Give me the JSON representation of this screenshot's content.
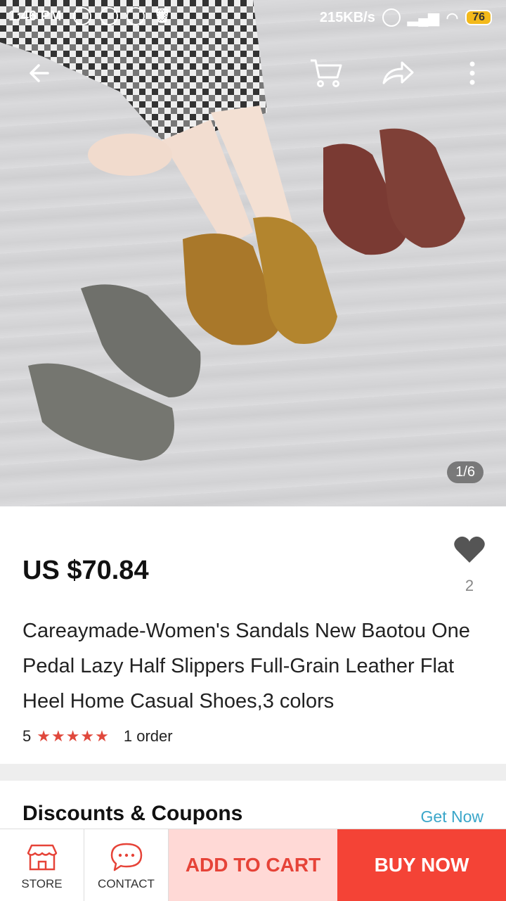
{
  "status": {
    "time": "1:46 PM",
    "speed": "215KB/s",
    "battery": "76"
  },
  "gallery": {
    "counter": "1/6"
  },
  "product": {
    "price": "US $70.84",
    "favorites": "2",
    "title": "Careaymade-Women's Sandals New Baotou One Pedal Lazy Half Slippers Full-Grain Leather Flat Heel Home Casual Shoes,3 colors",
    "rating": "5",
    "stars": "★★★★★",
    "orders": "1 order"
  },
  "discounts": {
    "title": "Discounts & Coupons",
    "action": "Get Now"
  },
  "bottom_bar": {
    "store": "STORE",
    "contact": "CONTACT",
    "add_to_cart": "ADD TO CART",
    "buy_now": "BUY NOW"
  },
  "colors": {
    "accent_red": "#f44336",
    "cart_pink": "#ffd9d6",
    "link_blue": "#3aa6c9",
    "star_red": "#e0483c"
  }
}
